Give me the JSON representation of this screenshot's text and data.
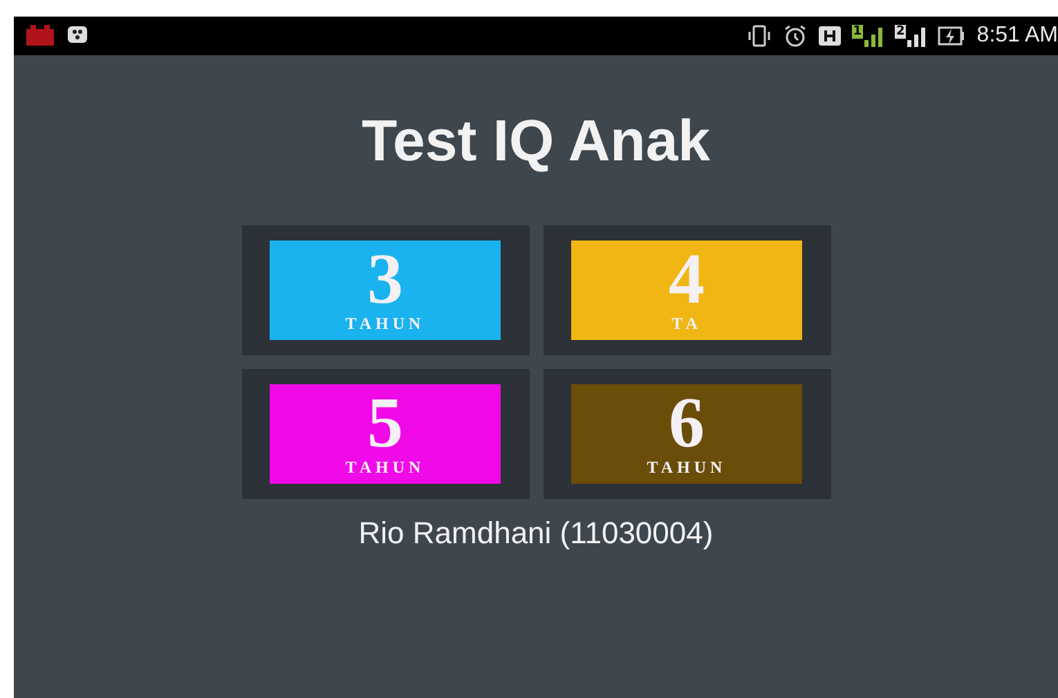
{
  "status_bar": {
    "time": "8:51 AM",
    "sims": [
      "1",
      "2"
    ]
  },
  "title": "Test IQ Anak",
  "tiles": [
    {
      "number": "3",
      "label": "TAHUN",
      "color": "#1ab2ef"
    },
    {
      "number": "4",
      "label": "TA",
      "color": "#f1b613"
    },
    {
      "number": "5",
      "label": "TAHUN",
      "color": "#f00ae8"
    },
    {
      "number": "6",
      "label": "TAHUN",
      "color": "#6b4d0a"
    }
  ],
  "footer": "Rio Ramdhani (11030004)"
}
